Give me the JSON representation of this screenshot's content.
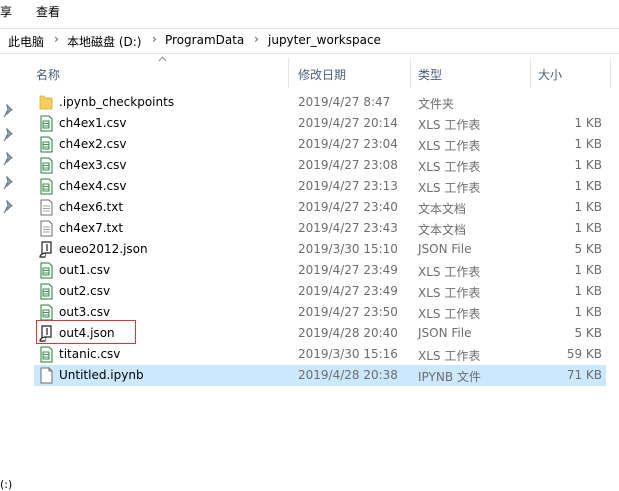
{
  "menu": [
    "享",
    "查看"
  ],
  "breadcrumb": [
    "此电脑",
    "本地磁盘 (D:)",
    "ProgramData",
    "jupyter_workspace"
  ],
  "nav_fragment": "(:)",
  "columns": {
    "name": "名称",
    "date": "修改日期",
    "type": "类型",
    "size": "大小"
  },
  "files": [
    {
      "name": ".ipynb_checkpoints",
      "date": "2019/4/27 8:47",
      "type": "文件夹",
      "size": "",
      "icon": "folder-icon"
    },
    {
      "name": "ch4ex1.csv",
      "date": "2019/4/27 20:14",
      "type": "XLS 工作表",
      "size": "1 KB",
      "icon": "csv-file-icon"
    },
    {
      "name": "ch4ex2.csv",
      "date": "2019/4/27 23:04",
      "type": "XLS 工作表",
      "size": "1 KB",
      "icon": "csv-file-icon"
    },
    {
      "name": "ch4ex3.csv",
      "date": "2019/4/27 23:08",
      "type": "XLS 工作表",
      "size": "1 KB",
      "icon": "csv-file-icon"
    },
    {
      "name": "ch4ex4.csv",
      "date": "2019/4/27 23:13",
      "type": "XLS 工作表",
      "size": "1 KB",
      "icon": "csv-file-icon"
    },
    {
      "name": "ch4ex6.txt",
      "date": "2019/4/27 23:40",
      "type": "文本文档",
      "size": "1 KB",
      "icon": "text-file-icon"
    },
    {
      "name": "ch4ex7.txt",
      "date": "2019/4/27 23:43",
      "type": "文本文档",
      "size": "1 KB",
      "icon": "text-file-icon"
    },
    {
      "name": "eueo2012.json",
      "date": "2019/3/30 15:10",
      "type": "JSON File",
      "size": "5 KB",
      "icon": "json-file-icon"
    },
    {
      "name": "out1.csv",
      "date": "2019/4/27 23:49",
      "type": "XLS 工作表",
      "size": "1 KB",
      "icon": "csv-file-icon"
    },
    {
      "name": "out2.csv",
      "date": "2019/4/27 23:49",
      "type": "XLS 工作表",
      "size": "1 KB",
      "icon": "csv-file-icon"
    },
    {
      "name": "out3.csv",
      "date": "2019/4/27 23:50",
      "type": "XLS 工作表",
      "size": "1 KB",
      "icon": "csv-file-icon"
    },
    {
      "name": "out4.json",
      "date": "2019/4/28 20:40",
      "type": "JSON File",
      "size": "5 KB",
      "icon": "json-file-icon"
    },
    {
      "name": "titanic.csv",
      "date": "2019/3/30 15:16",
      "type": "XLS 工作表",
      "size": "59 KB",
      "icon": "csv-file-icon"
    },
    {
      "name": "Untitled.ipynb",
      "date": "2019/4/28 20:38",
      "type": "IPYNB 文件",
      "size": "71 KB",
      "icon": "blank-file-icon",
      "selected": true
    }
  ],
  "highlighted_file_index": 11,
  "colors": {
    "selection": "#cce8ff",
    "highlight_border": "#d9363e",
    "header_text": "#4c607a",
    "detail_text": "#6d6d6d",
    "folder": "#f7cf5a",
    "csv_green": "#1e7e34"
  }
}
